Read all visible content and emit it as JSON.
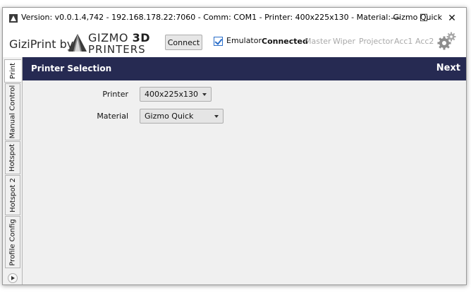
{
  "window": {
    "title": "Version: v0.0.1.4,742 - 192.168.178.22:7060 - Comm: COM1 - Printer: 400x225x130 - Material: Gizmo Quick",
    "controls": {
      "minimize": "—",
      "maximize": "☐",
      "close": "✕"
    }
  },
  "toolbar": {
    "brand": "GiziPrint by",
    "logo": {
      "line1": "GIZMO",
      "line1_bold": "3D",
      "line2": "PRINTERS"
    },
    "connect_label": "Connect",
    "emulator": {
      "label": "Emulator",
      "checked": true
    },
    "statuses": [
      {
        "label": "Connected",
        "active": true
      },
      {
        "label": "Master",
        "active": false
      },
      {
        "label": "Wiper",
        "active": false
      },
      {
        "label": "Projector",
        "active": false
      },
      {
        "label": "Acc1",
        "active": false
      },
      {
        "label": "Acc2",
        "active": false
      }
    ],
    "settings_icon": "gear-icon"
  },
  "tabs": [
    {
      "label": "Print",
      "active": true
    },
    {
      "label": "Manual Control",
      "active": false
    },
    {
      "label": "Hotspot",
      "active": false
    },
    {
      "label": "Hotspot 2",
      "active": false
    },
    {
      "label": "Profile Config",
      "active": false
    }
  ],
  "page": {
    "title": "Printer Selection",
    "next_label": "Next",
    "fields": {
      "printer": {
        "label": "Printer",
        "value": "400x225x130"
      },
      "material": {
        "label": "Material",
        "value": "Gizmo Quick"
      }
    }
  },
  "colors": {
    "header": "#262a52",
    "accent": "#2a6ec9",
    "inactive_status": "#a9a9a9"
  }
}
